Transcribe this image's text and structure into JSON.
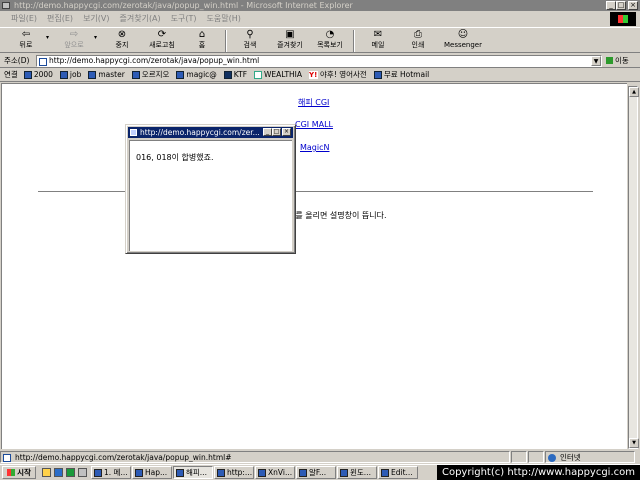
{
  "window": {
    "title": "http://demo.happycgi.com/zerotak/java/popup_win.html - Microsoft Internet Explorer"
  },
  "menu": [
    "파일(E)",
    "편집(E)",
    "보기(V)",
    "즐겨찾기(A)",
    "도구(T)",
    "도움말(H)"
  ],
  "toolbar": {
    "back": "뒤로",
    "forward": "앞으로",
    "stop": "중지",
    "refresh": "새로고침",
    "home": "홈",
    "search": "검색",
    "favorites": "즐겨찾기",
    "history": "목록보기",
    "mail": "메일",
    "print": "인쇄",
    "messenger": "Messenger"
  },
  "address": {
    "label": "주소(D)",
    "url": "http://demo.happycgi.com/zerotak/java/popup_win.html",
    "go": "이동"
  },
  "links": {
    "label": "연결",
    "items": [
      "2000",
      "job",
      "master",
      "오르지오",
      "magic@",
      "KTF",
      "WEALTHIA",
      "야후! 영어사전",
      "무료 Hotmail"
    ],
    "yahoo_glyph": "Y!"
  },
  "page": {
    "link1": "해피 CGI",
    "link2": "CGI MALL",
    "link3": "MagicN",
    "hint": "스를 올리면 설명창이 뜹니다."
  },
  "popup": {
    "title": "http://demo.happycgi.com/zer...",
    "message": "016, 018이 합병했죠."
  },
  "status": {
    "url": "http://demo.happycgi.com/zerotak/java/popup_win.html#",
    "zone": "인터넷"
  },
  "taskbar": {
    "start": "시작",
    "tasks": [
      "1. 메...",
      "Hap...",
      "해피...",
      "http:...",
      "XnVi...",
      "알F...",
      "윈도...",
      "Edit..."
    ]
  },
  "copyright": "Copyright(c) http://www.happycgi.com"
}
